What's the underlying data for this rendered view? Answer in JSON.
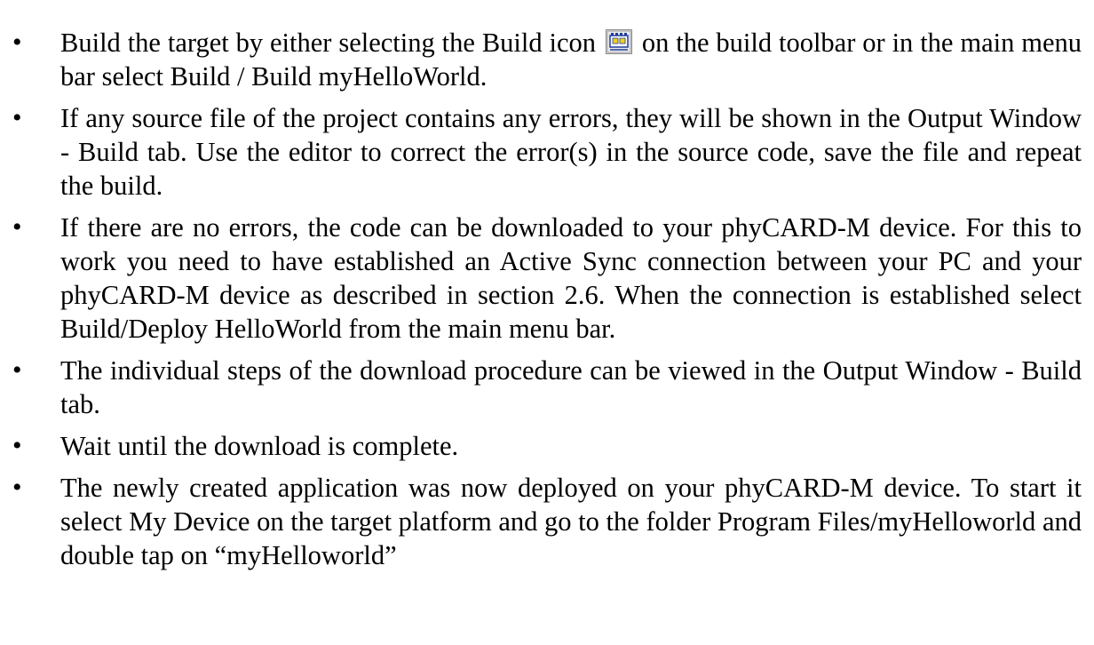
{
  "bullets": [
    {
      "before_icon": "Build the target by either selecting the Build icon",
      "icon": "build-icon",
      "after_icon": " on the build toolbar or in the main menu bar select Build / Build myHelloWorld."
    },
    {
      "text": "If any source file of the project contains any errors, they will be shown in the Output Window - Build tab. Use the editor to correct the error(s) in the source code, save the file and repeat the build."
    },
    {
      "text": "If there are no errors, the code can be downloaded to your phyCARD-M device. For this to work you need to have established an Active Sync connection between your PC and your phyCARD-M device as described in section 2.6. When the connection is established select Build/Deploy HelloWorld from the main menu bar."
    },
    {
      "text": "The individual steps of the download procedure can be viewed in the Output Window - Build tab."
    },
    {
      "text": "Wait until the download is complete."
    },
    {
      "text": "The newly created application was now deployed on your phyCARD-M device. To start it select My Device on the target platform and go to the folder Program Files/myHelloworld and double tap on “myHelloworld”"
    }
  ],
  "bullet_glyph": "•",
  "colors": {
    "text": "#000000",
    "icon_blue": "#1f3d9b",
    "icon_yellow": "#f2d21b"
  }
}
